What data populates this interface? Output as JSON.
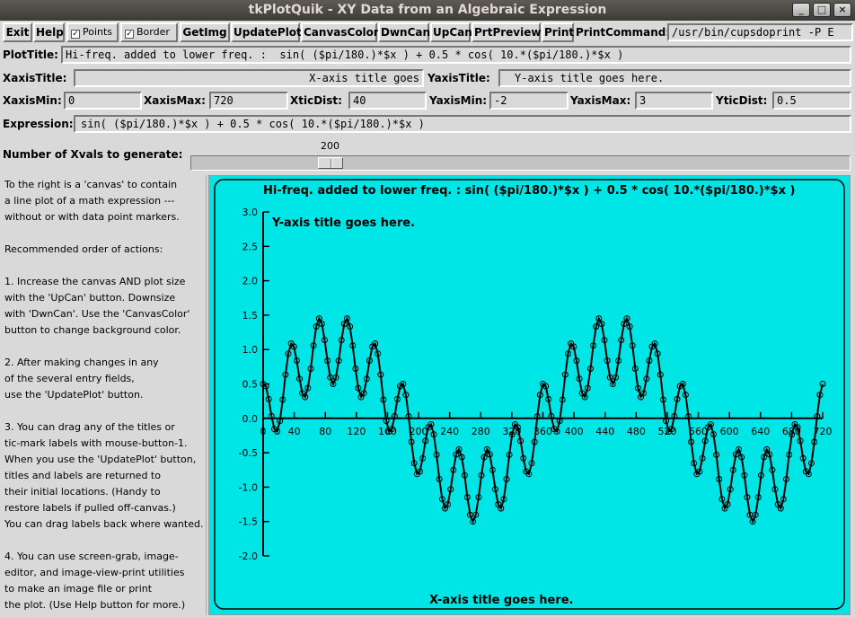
{
  "window": {
    "title": "tkPlotQuik - XY Data from an Algebraic Expression",
    "controls": [
      "_",
      "□",
      "×"
    ]
  },
  "toolbar": {
    "exit_label": "Exit",
    "help_label": "Help",
    "points_label": "Points",
    "points_checked": true,
    "border_label": "Border",
    "border_checked": true,
    "getimg_label": "GetImg",
    "updateplot_label": "UpdatePlot",
    "canvascolor_label": "CanvasColor",
    "dwncan_label": "DwnCan",
    "upcan_label": "UpCan",
    "prtpreview_label": "PrtPreview",
    "print_label": "Print",
    "printcommand_label": "PrintCommand:",
    "printcommand_value": "/usr/bin/cupsdoprint -P E"
  },
  "form": {
    "plottitle_label": "PlotTitle:",
    "plottitle_value": "Hi-freq. added to lower freq. :  sin( ($pi/180.)*$x ) + 0.5 * cos( 10.*($pi/180.)*$x )",
    "xaxistitle_label": "XaxisTitle:",
    "xaxistitle_value": "X-axis title goes",
    "yaxistitle_label": "YaxisTitle:",
    "yaxistitle_value": "Y-axis title goes here.",
    "xaxismin_label": "XaxisMin:",
    "xaxismin_value": "0",
    "xaxismax_label": "XaxisMax:",
    "xaxismax_value": "720",
    "xticdist_label": "XticDist:",
    "xticdist_value": "40",
    "yaxismin_label": "YaxisMin:",
    "yaxismin_value": "-2",
    "yaxismax_label": "YaxisMax:",
    "yaxismax_value": "3",
    "yticdist_label": "YticDist:",
    "yticdist_value": "0.5",
    "expression_label": "Expression:",
    "expression_value": "sin( ($pi/180.)*$x ) + 0.5 * cos( 10.*($pi/180.)*$x )"
  },
  "slider": {
    "label": "Number of Xvals to generate:",
    "value": "200",
    "min": 0,
    "max": 1000
  },
  "help_text": [
    "To the right is a 'canvas' to contain",
    "a line plot of a math expression ---",
    "without or with data point markers.",
    "",
    "Recommended order of actions:",
    "",
    "1. Increase the canvas AND plot size",
    "with the 'UpCan' button. Downsize",
    "with 'DwnCan'. Use the 'CanvasColor'",
    "button to change background color.",
    "",
    "2. After making changes in any",
    "of the several entry fields,",
    "use the 'UpdatePlot' button.",
    "",
    "3. You can drag any of the titles or",
    "tic-mark labels with mouse-button-1.",
    "When you use the 'UpdatePlot' button,",
    "titles and labels are returned to",
    "their initial locations. (Handy to",
    "restore labels if pulled off-canvas.)",
    "You can drag labels back where wanted.",
    "",
    "4. You can use screen-grab, image-",
    "editor, and image-view-print utilities",
    "to make an image file or print",
    "the plot. (Use Help button for more.)"
  ],
  "colors": {
    "canvas_bg": "#00e6e6",
    "plot_line": "#000000"
  },
  "chart_data": {
    "type": "line",
    "title": "Hi-freq. added to lower freq. :  sin( ($pi/180.)*$x ) + 0.5 * cos( 10.*($pi/180.)*$x )",
    "xlabel": "X-axis title goes here.",
    "ylabel": "Y-axis title goes here.",
    "xlim": [
      0,
      720
    ],
    "ylim": [
      -2,
      3
    ],
    "x_ticks": [
      0,
      40,
      80,
      120,
      160,
      200,
      240,
      280,
      320,
      360,
      400,
      440,
      480,
      520,
      560,
      600,
      640,
      680,
      720
    ],
    "x_tick_labels": [
      "0",
      "40",
      "80",
      "120",
      "160",
      "200",
      "240",
      "280",
      "320",
      "360",
      "400",
      "440",
      "480",
      "520",
      "560",
      "600",
      "640",
      "680",
      "720"
    ],
    "y_ticks": [
      -2,
      -1.5,
      -1,
      -0.5,
      0,
      0.5,
      1,
      1.5,
      2,
      2.5,
      3
    ],
    "y_tick_labels": [
      "-2.0",
      "-1.5",
      "-1.0",
      "-0.5",
      "0.0",
      "0.5",
      "1.0",
      "1.5",
      "2.0",
      "2.5",
      "3.0"
    ],
    "markers": true,
    "num_points": 200,
    "expression": "sin( ($pi/180.)*$x ) + 0.5 * cos( 10.*($pi/180.)*$x )"
  }
}
